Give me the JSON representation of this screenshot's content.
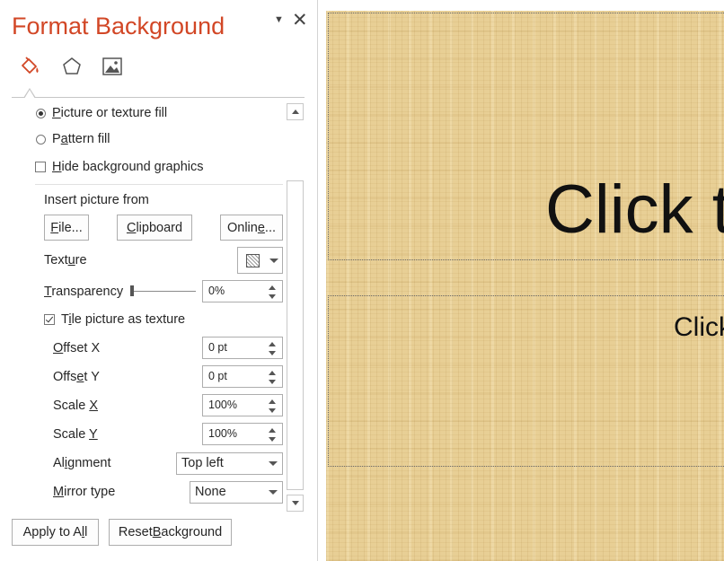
{
  "pane": {
    "title": "Format Background",
    "menu_icon": "chevron-down-icon",
    "close_icon": "close-icon",
    "tabs": [
      {
        "name": "fill-tab",
        "icon": "paint-bucket-icon"
      },
      {
        "name": "effects-tab",
        "icon": "pentagon-icon"
      },
      {
        "name": "picture-tab",
        "icon": "image-icon"
      }
    ],
    "title_color": "#d24726"
  },
  "fill": {
    "picture_or_texture": {
      "label_pre": "",
      "label_u": "P",
      "label_post": "icture or texture fill",
      "selected": true
    },
    "pattern": {
      "label_pre": "P",
      "label_u": "a",
      "label_post": "ttern fill",
      "selected": false
    },
    "hide_graphics": {
      "label_pre": "",
      "label_u": "H",
      "label_post": "ide background graphics",
      "checked": false
    }
  },
  "insert": {
    "heading": "Insert picture from",
    "file": {
      "u": "F",
      "rest": "ile..."
    },
    "clipboard": {
      "u": "C",
      "rest": "lipboard"
    },
    "online": {
      "pre": "Onlin",
      "u": "e",
      "rest": "..."
    }
  },
  "texture": {
    "pre": "Text",
    "u": "u",
    "post": "re"
  },
  "transparency": {
    "pre": "",
    "u": "T",
    "post": "ransparency",
    "value": "0%",
    "level": 0
  },
  "tile": {
    "pre": "T",
    "u": "i",
    "post": "le picture as texture",
    "checked": true
  },
  "offset_x": {
    "pre": "",
    "u": "O",
    "post": "ffset X",
    "value": "0 pt"
  },
  "offset_y": {
    "pre": "Offs",
    "u": "e",
    "post": "t Y",
    "value": "0 pt"
  },
  "scale_x": {
    "pre": "Scale ",
    "u": "X",
    "post": "",
    "value": "100%"
  },
  "scale_y": {
    "pre": "Scale ",
    "u": "Y",
    "post": "",
    "value": "100%"
  },
  "alignment": {
    "pre": "Al",
    "u": "i",
    "post": "gnment",
    "value": "Top left"
  },
  "mirror": {
    "pre": "",
    "u": "M",
    "post": "irror type",
    "value": "None"
  },
  "footer": {
    "apply_all": {
      "pre": "Apply to A",
      "u": "l",
      "post": "l"
    },
    "reset": {
      "pre": "Reset ",
      "u": "B",
      "post": "ackground"
    }
  },
  "slide": {
    "title_text": "Click t",
    "subtitle_text": "Click",
    "background_color": "#e8cf95"
  }
}
